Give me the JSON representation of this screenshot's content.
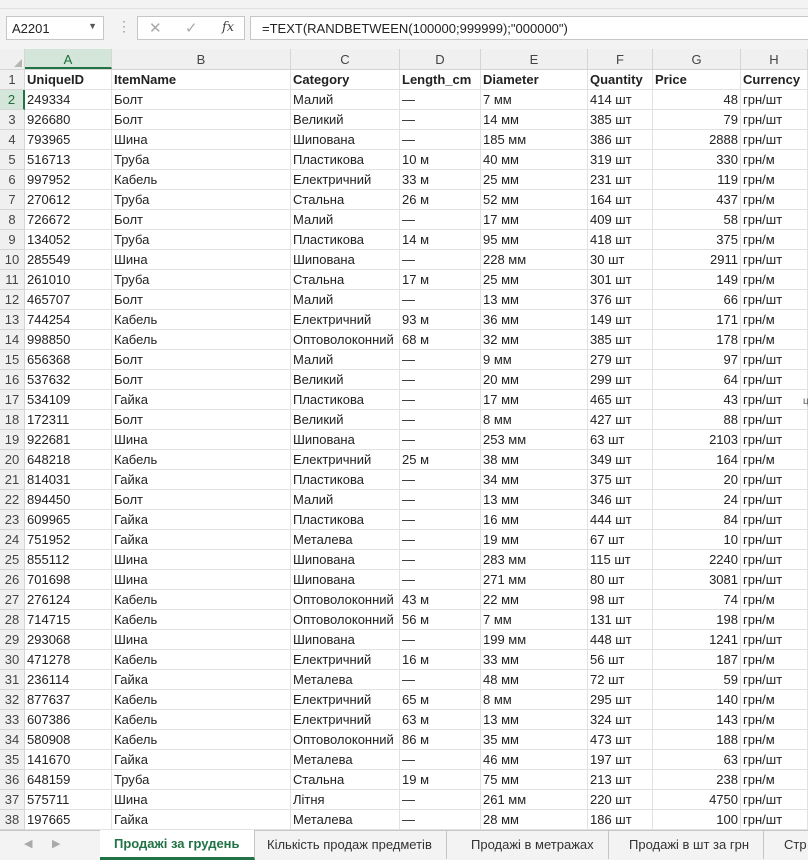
{
  "formula_bar": {
    "name_box": "A2201",
    "cancel_symbol": "✕",
    "enter_symbol": "✓",
    "fx_label": "fx",
    "formula": "=TEXT(RANDBETWEEN(100000;999999);\"000000\")"
  },
  "column_letters": [
    "A",
    "B",
    "C",
    "D",
    "E",
    "F",
    "G",
    "H"
  ],
  "headers": [
    "UniqueID",
    "ItemName",
    "Category",
    "Length_cm",
    "Diameter",
    "Quantity",
    "Price",
    "Currency"
  ],
  "rows": [
    [
      "249334",
      "Болт",
      "Малий",
      "—",
      "7 мм",
      "414 шт",
      "48",
      "грн/шт"
    ],
    [
      "926680",
      "Болт",
      "Великий",
      "—",
      "14 мм",
      "385 шт",
      "79",
      "грн/шт"
    ],
    [
      "793965",
      "Шина",
      "Шипована",
      "—",
      "185 мм",
      "386 шт",
      "2888",
      "грн/шт"
    ],
    [
      "516713",
      "Труба",
      "Пластикова",
      "10 м",
      "40 мм",
      "319 шт",
      "330",
      "грн/м"
    ],
    [
      "997952",
      "Кабель",
      "Електричний",
      "33 м",
      "25 мм",
      "231 шт",
      "119",
      "грн/м"
    ],
    [
      "270612",
      "Труба",
      "Стальна",
      "26 м",
      "52 мм",
      "164 шт",
      "437",
      "грн/м"
    ],
    [
      "726672",
      "Болт",
      "Малий",
      "—",
      "17 мм",
      "409 шт",
      "58",
      "грн/шт"
    ],
    [
      "134052",
      "Труба",
      "Пластикова",
      "14 м",
      "95 мм",
      "418 шт",
      "375",
      "грн/м"
    ],
    [
      "285549",
      "Шина",
      "Шипована",
      "—",
      "228 мм",
      "30 шт",
      "2911",
      "грн/шт"
    ],
    [
      "261010",
      "Труба",
      "Стальна",
      "17 м",
      "25 мм",
      "301 шт",
      "149",
      "грн/м"
    ],
    [
      "465707",
      "Болт",
      "Малий",
      "—",
      "13 мм",
      "376 шт",
      "66",
      "грн/шт"
    ],
    [
      "744254",
      "Кабель",
      "Електричний",
      "93 м",
      "36 мм",
      "149 шт",
      "171",
      "грн/м"
    ],
    [
      "998850",
      "Кабель",
      "Оптоволоконний",
      "68 м",
      "32 мм",
      "385 шт",
      "178",
      "грн/м"
    ],
    [
      "656368",
      "Болт",
      "Малий",
      "—",
      "9 мм",
      "279 шт",
      "97",
      "грн/шт"
    ],
    [
      "537632",
      "Болт",
      "Великий",
      "—",
      "20 мм",
      "299 шт",
      "64",
      "грн/шт"
    ],
    [
      "534109",
      "Гайка",
      "Пластикова",
      "—",
      "17 мм",
      "465 шт",
      "43",
      "грн/шт"
    ],
    [
      "172311",
      "Болт",
      "Великий",
      "—",
      "8 мм",
      "427 шт",
      "88",
      "грн/шт"
    ],
    [
      "922681",
      "Шина",
      "Шипована",
      "—",
      "253 мм",
      "63 шт",
      "2103",
      "грн/шт"
    ],
    [
      "648218",
      "Кабель",
      "Електричний",
      "25 м",
      "38 мм",
      "349 шт",
      "164",
      "грн/м"
    ],
    [
      "814031",
      "Гайка",
      "Пластикова",
      "—",
      "34 мм",
      "375 шт",
      "20",
      "грн/шт"
    ],
    [
      "894450",
      "Болт",
      "Малий",
      "—",
      "13 мм",
      "346 шт",
      "24",
      "грн/шт"
    ],
    [
      "609965",
      "Гайка",
      "Пластикова",
      "—",
      "16 мм",
      "444 шт",
      "84",
      "грн/шт"
    ],
    [
      "751952",
      "Гайка",
      "Металева",
      "—",
      "19 мм",
      "67 шт",
      "10",
      "грн/шт"
    ],
    [
      "855112",
      "Шина",
      "Шипована",
      "—",
      "283 мм",
      "115 шт",
      "2240",
      "грн/шт"
    ],
    [
      "701698",
      "Шина",
      "Шипована",
      "—",
      "271 мм",
      "80 шт",
      "3081",
      "грн/шт"
    ],
    [
      "276124",
      "Кабель",
      "Оптоволоконний",
      "43 м",
      "22 мм",
      "98 шт",
      "74",
      "грн/м"
    ],
    [
      "714715",
      "Кабель",
      "Оптоволоконний",
      "56 м",
      "7 мм",
      "131 шт",
      "198",
      "грн/м"
    ],
    [
      "293068",
      "Шина",
      "Шипована",
      "—",
      "199 мм",
      "448 шт",
      "1241",
      "грн/шт"
    ],
    [
      "471278",
      "Кабель",
      "Електричний",
      "16 м",
      "33 мм",
      "56 шт",
      "187",
      "грн/м"
    ],
    [
      "236114",
      "Гайка",
      "Металева",
      "—",
      "48 мм",
      "72 шт",
      "59",
      "грн/шт"
    ],
    [
      "877637",
      "Кабель",
      "Електричний",
      "65 м",
      "8 мм",
      "295 шт",
      "140",
      "грн/м"
    ],
    [
      "607386",
      "Кабель",
      "Електричний",
      "63 м",
      "13 мм",
      "324 шт",
      "143",
      "грн/м"
    ],
    [
      "580908",
      "Кабель",
      "Оптоволоконний",
      "86 м",
      "35 мм",
      "473 шт",
      "188",
      "грн/м"
    ],
    [
      "141670",
      "Гайка",
      "Металева",
      "—",
      "46 мм",
      "197 шт",
      "63",
      "грн/шт"
    ],
    [
      "648159",
      "Труба",
      "Стальна",
      "19 м",
      "75 мм",
      "213 шт",
      "238",
      "грн/м"
    ],
    [
      "575711",
      "Шина",
      "Літня",
      "—",
      "261 мм",
      "220 шт",
      "4750",
      "грн/шт"
    ],
    [
      "197665",
      "Гайка",
      "Металева",
      "—",
      "28 мм",
      "186 шт",
      "100",
      "грн/шт"
    ]
  ],
  "sheet_tabs": [
    "Продажі за грудень",
    "Кількість продаж предметів",
    "Продажі в метражах",
    "Продажі в шт за грн",
    "Стр"
  ],
  "active_tab": 0,
  "colors": {
    "accent": "#217346",
    "selected_header_bg": "#d3e6d9"
  }
}
